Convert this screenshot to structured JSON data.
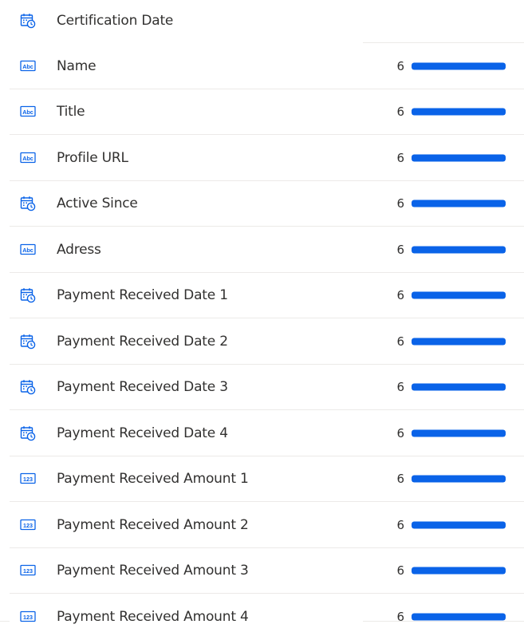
{
  "accent_color": "#0a63e8",
  "header_field": {
    "label": "Certification Date",
    "icon": "calendar-clock-icon"
  },
  "fields": [
    {
      "label": "Name",
      "icon": "text-abc-icon",
      "count": "6",
      "fill": 1.0
    },
    {
      "label": "Title",
      "icon": "text-abc-icon",
      "count": "6",
      "fill": 1.0
    },
    {
      "label": "Profile URL",
      "icon": "text-abc-icon",
      "count": "6",
      "fill": 1.0
    },
    {
      "label": "Active Since",
      "icon": "calendar-clock-icon",
      "count": "6",
      "fill": 1.0
    },
    {
      "label": "Adress",
      "icon": "text-abc-icon",
      "count": "6",
      "fill": 1.0
    },
    {
      "label": "Payment Received Date 1",
      "icon": "calendar-clock-icon",
      "count": "6",
      "fill": 1.0
    },
    {
      "label": "Payment Received Date 2",
      "icon": "calendar-clock-icon",
      "count": "6",
      "fill": 1.0
    },
    {
      "label": "Payment Received Date 3",
      "icon": "calendar-clock-icon",
      "count": "6",
      "fill": 1.0
    },
    {
      "label": "Payment Received Date 4",
      "icon": "calendar-clock-icon",
      "count": "6",
      "fill": 1.0
    },
    {
      "label": "Payment Received Amount 1",
      "icon": "number-123-icon",
      "count": "6",
      "fill": 1.0
    },
    {
      "label": "Payment Received Amount 2",
      "icon": "number-123-icon",
      "count": "6",
      "fill": 1.0
    },
    {
      "label": "Payment Received Amount 3",
      "icon": "number-123-icon",
      "count": "6",
      "fill": 1.0
    },
    {
      "label": "Payment Received Amount 4",
      "icon": "number-123-icon",
      "count": "6",
      "fill": 1.0
    }
  ]
}
